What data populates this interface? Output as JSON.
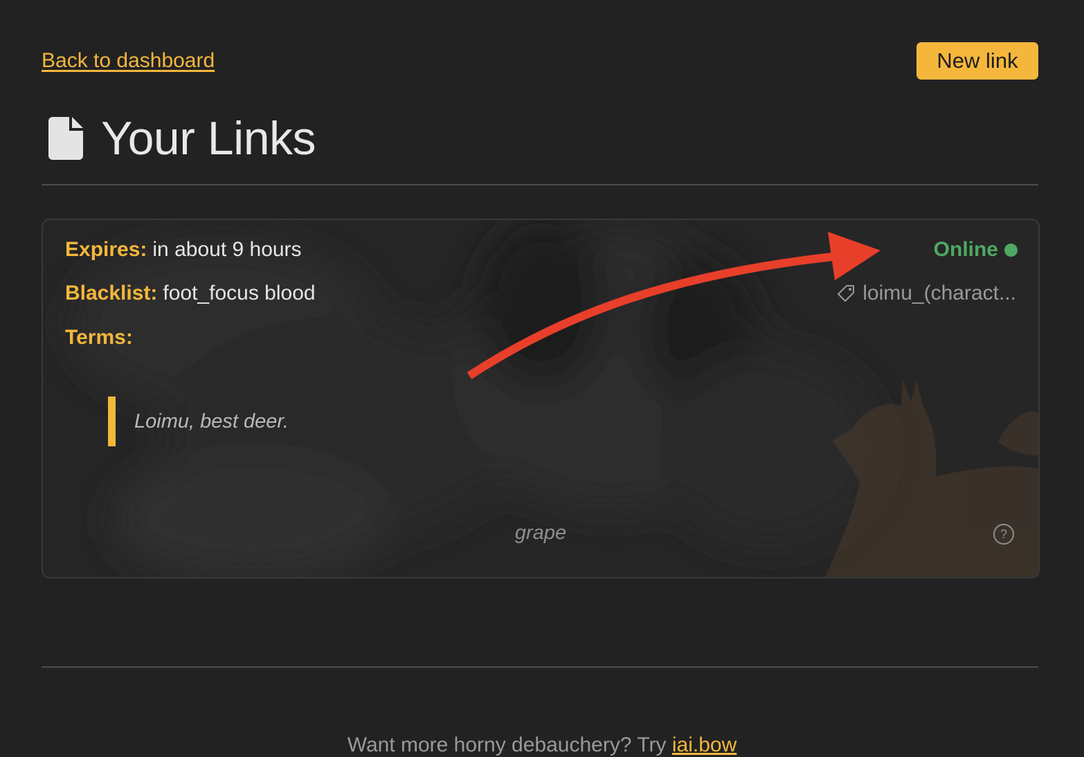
{
  "nav": {
    "back_label": "Back to dashboard",
    "new_link_label": "New link"
  },
  "page": {
    "title": "Your Links",
    "title_icon": "file-icon"
  },
  "link_card": {
    "expires_label": "Expires:",
    "expires_value": "in about 9 hours",
    "blacklist_label": "Blacklist:",
    "blacklist_value": "foot_focus blood",
    "terms_label": "Terms:",
    "quote": "Loimu, best deer.",
    "status": "Online",
    "status_color": "#4fa862",
    "tag_icon": "tag-icon",
    "tag_label": "loimu_(charact...",
    "artist": "grape",
    "help_icon": "question-circle-icon"
  },
  "annotation": {
    "type": "arrow",
    "color": "#e83f2a"
  },
  "footer": {
    "text": "Want more horny debauchery? Try ",
    "link_label": "iai.bow"
  },
  "colors": {
    "accent": "#f5b73b",
    "background": "#222222",
    "online": "#4fa862"
  }
}
